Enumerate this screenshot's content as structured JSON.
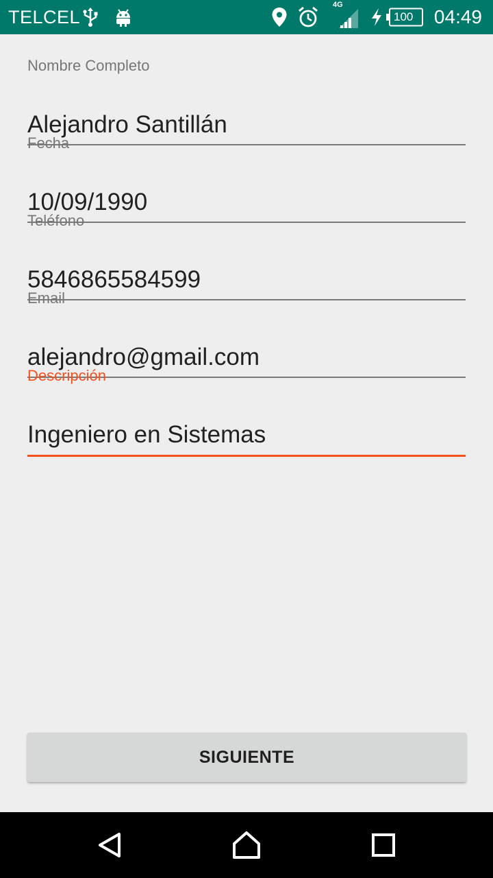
{
  "status_bar": {
    "carrier": "TELCEL",
    "network_type": "4G",
    "battery": "100",
    "time": "04:49",
    "icons": [
      "usb-icon",
      "android-icon",
      "location-icon",
      "alarm-icon",
      "signal-icon",
      "charging-icon",
      "battery-icon"
    ]
  },
  "form": {
    "fields": [
      {
        "label": "Nombre Completo",
        "value": "Alejandro Santillán"
      },
      {
        "label": "Fecha",
        "value": "10/09/1990"
      },
      {
        "label": "Teléfono",
        "value": "5846865584599"
      },
      {
        "label": "Email",
        "value": "alejandro@gmail.com"
      },
      {
        "label": "Descripción",
        "value": "Ingeniero en Sistemas"
      }
    ],
    "focused_field": "Descripción",
    "accent_color": "#f4511e"
  },
  "actions": {
    "next_label": "SIGUIENTE"
  },
  "navigation": {
    "icons": [
      "back-icon",
      "home-icon",
      "recents-icon"
    ]
  },
  "colors": {
    "status_bar": "#00796b",
    "background": "#eeeeee",
    "button": "#d6d7d7"
  }
}
